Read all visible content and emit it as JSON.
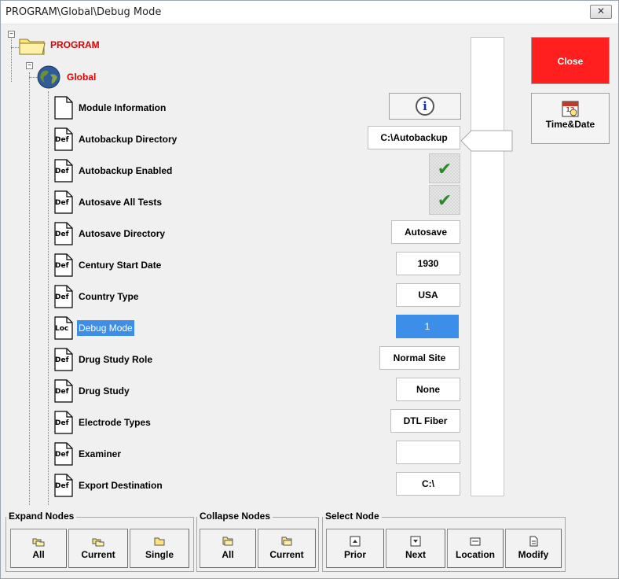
{
  "window": {
    "title": "PROGRAM\\Global\\Debug Mode",
    "close_glyph": "✕"
  },
  "tree": {
    "root": {
      "label": "PROGRAM",
      "icon": "folder-icon"
    },
    "group": {
      "label": "Global",
      "icon": "globe-icon"
    },
    "items": [
      {
        "label": "Module Information",
        "badge": "",
        "value": "",
        "kind": "info"
      },
      {
        "label": "Autobackup Directory",
        "badge": "Def",
        "value": "C:\\Autobackup",
        "kind": "text"
      },
      {
        "label": "Autobackup Enabled",
        "badge": "Def",
        "value": "✔",
        "kind": "check"
      },
      {
        "label": "Autosave All Tests",
        "badge": "Def",
        "value": "✔",
        "kind": "check"
      },
      {
        "label": "Autosave Directory",
        "badge": "Def",
        "value": "Autosave",
        "kind": "text"
      },
      {
        "label": "Century Start Date",
        "badge": "Def",
        "value": "1930",
        "kind": "text"
      },
      {
        "label": "Country Type",
        "badge": "Def",
        "value": "USA",
        "kind": "text"
      },
      {
        "label": "Debug Mode",
        "badge": "Loc",
        "value": "1",
        "kind": "text",
        "selected": true
      },
      {
        "label": "Drug Study Role",
        "badge": "Def",
        "value": "Normal Site",
        "kind": "text"
      },
      {
        "label": "Drug Study",
        "badge": "Def",
        "value": "None",
        "kind": "text"
      },
      {
        "label": "Electrode Types",
        "badge": "Def",
        "value": "DTL Fiber",
        "kind": "text"
      },
      {
        "label": "Examiner",
        "badge": "Def",
        "value": "",
        "kind": "text"
      },
      {
        "label": "Export Destination",
        "badge": "Def",
        "value": "C:\\",
        "kind": "text"
      }
    ]
  },
  "side": {
    "close_label": "Close",
    "timedate_label": "Time&Date",
    "info_glyph": "i"
  },
  "toolbar": {
    "expand": {
      "title": "Expand Nodes",
      "buttons": [
        "All",
        "Current",
        "Single"
      ]
    },
    "collapse": {
      "title": "Collapse Nodes",
      "buttons": [
        "All",
        "Current"
      ]
    },
    "select": {
      "title": "Select Node",
      "buttons": [
        "Prior",
        "Next",
        "Location",
        "Modify"
      ]
    }
  },
  "colors": {
    "close_bg": "#ff1f1f",
    "selection": "#3d8ee8",
    "tree_label_red": "#e00000",
    "check": "#2a8a2a"
  }
}
